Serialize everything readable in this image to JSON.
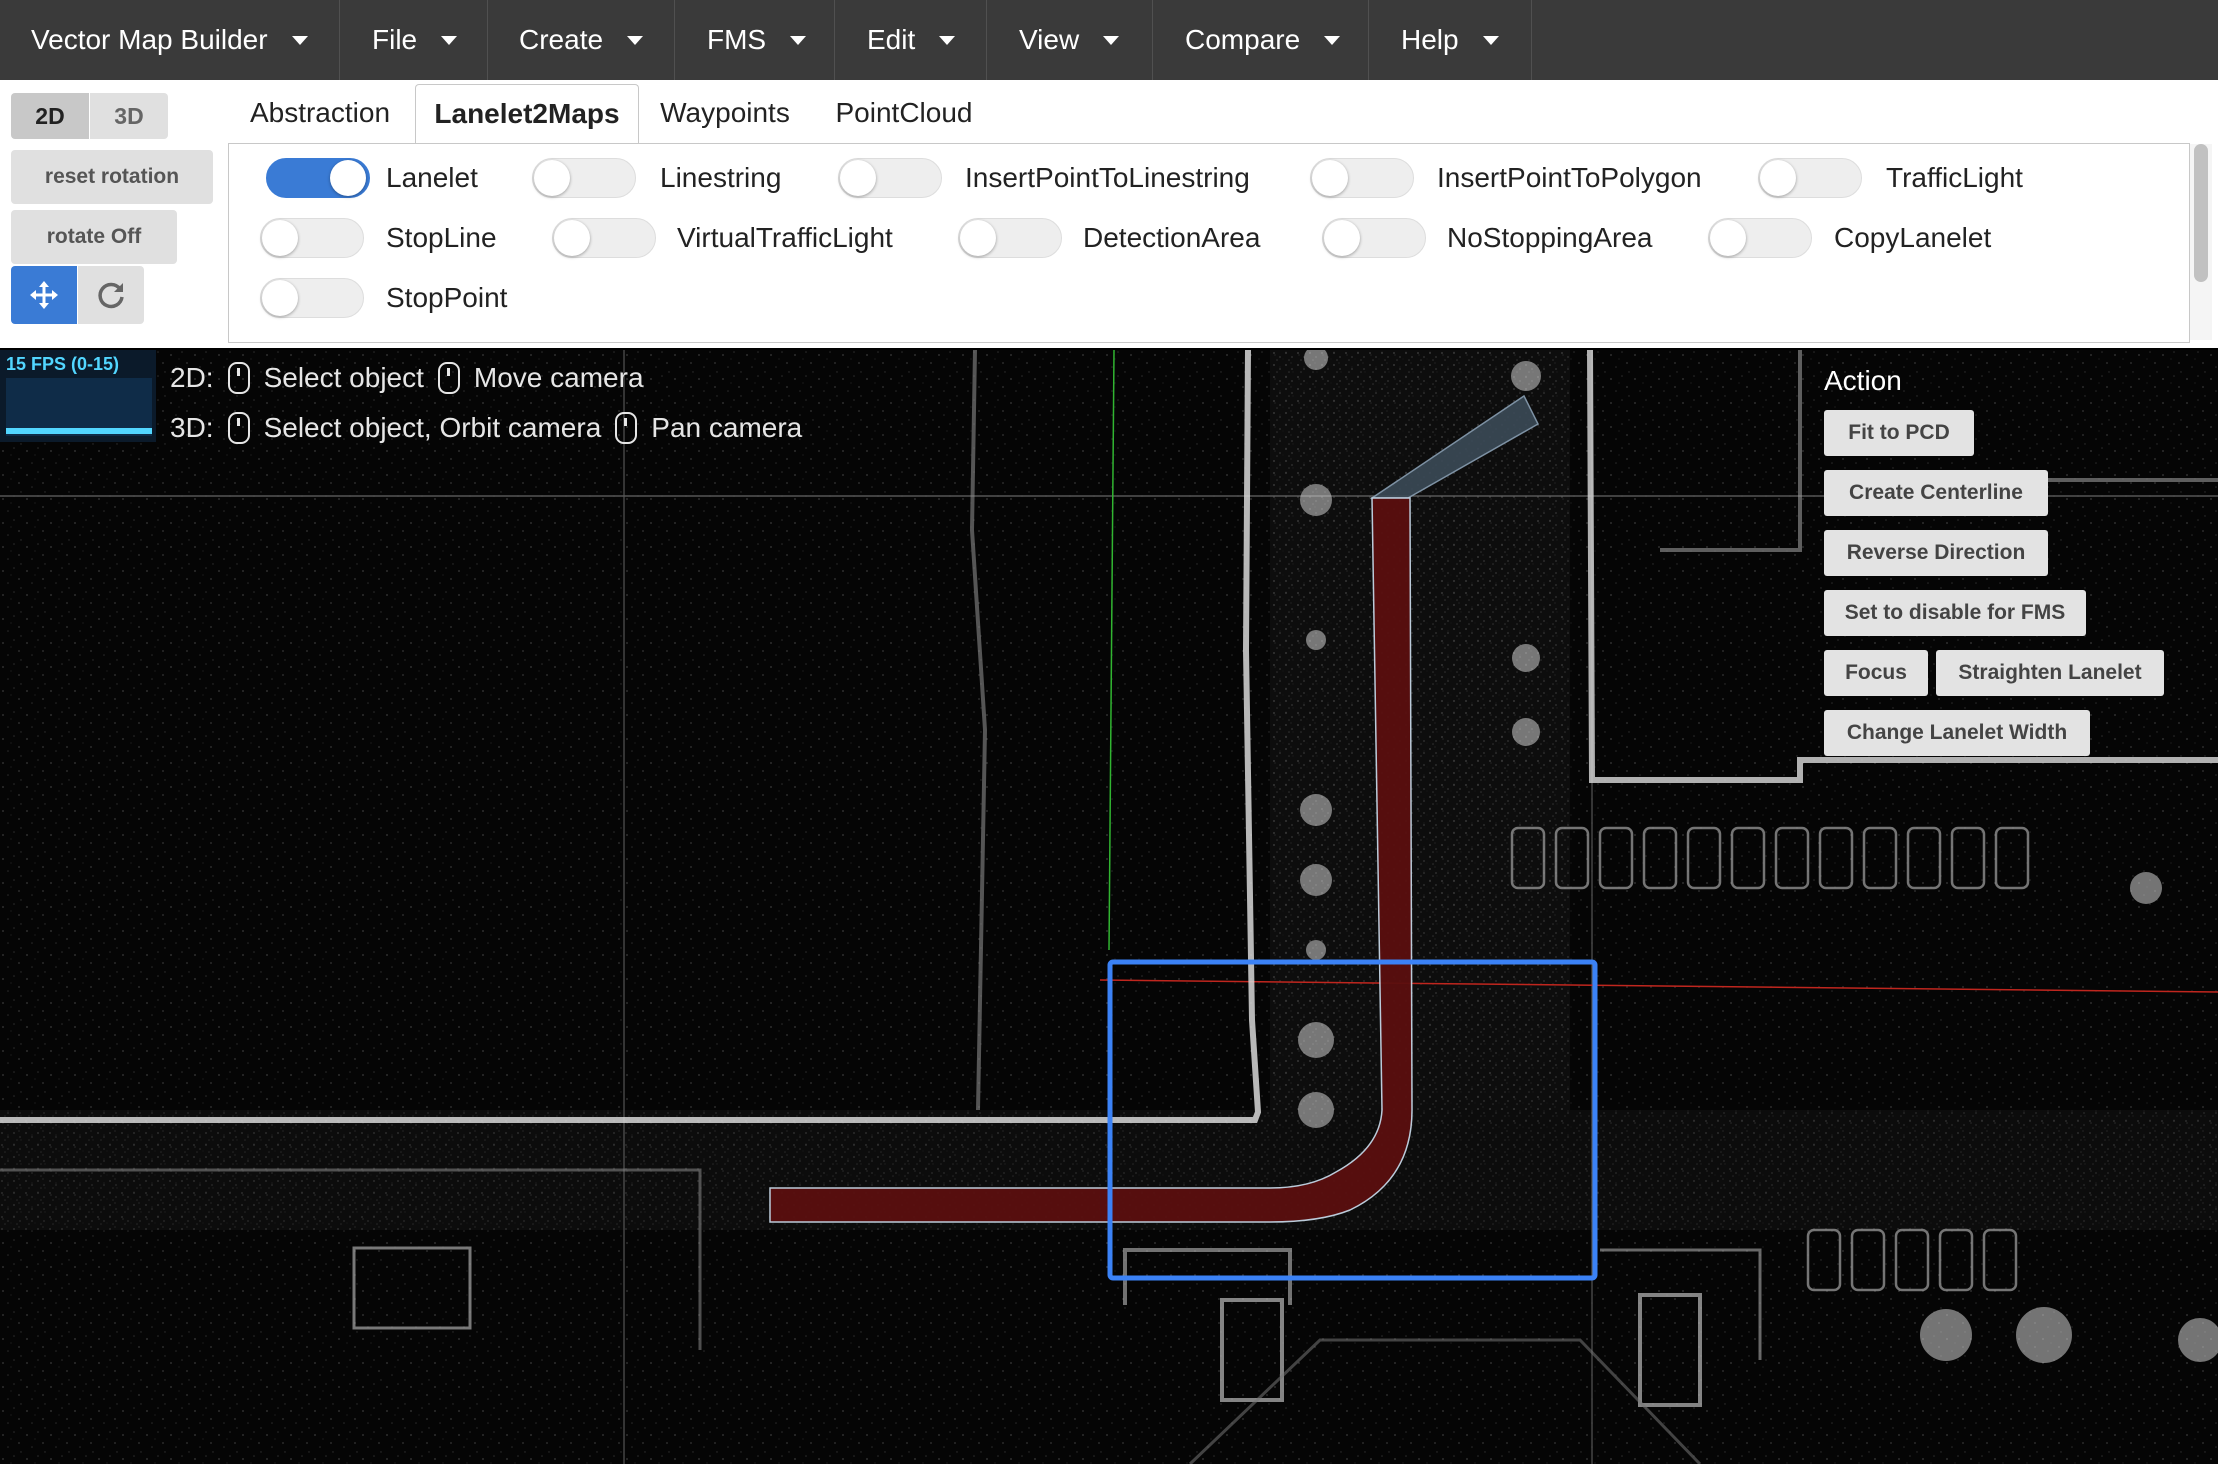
{
  "menubar": {
    "items": [
      "Vector Map Builder",
      "File",
      "Create",
      "FMS",
      "Edit",
      "View",
      "Compare",
      "Help"
    ]
  },
  "view_mode": {
    "options": [
      "2D",
      "3D"
    ],
    "selected": "2D"
  },
  "controls": {
    "reset_rotation": "reset rotation",
    "rotate": "rotate Off"
  },
  "tool_buttons": {
    "move": "move-arrows-icon",
    "refresh": "refresh-icon"
  },
  "tabs": {
    "items": [
      "Abstraction",
      "Lanelet2Maps",
      "Waypoints",
      "PointCloud"
    ],
    "active": "Lanelet2Maps"
  },
  "toggles": [
    {
      "label": "Lanelet",
      "on": true
    },
    {
      "label": "Linestring",
      "on": false
    },
    {
      "label": "InsertPointToLinestring",
      "on": false
    },
    {
      "label": "InsertPointToPolygon",
      "on": false
    },
    {
      "label": "TrafficLight",
      "on": false
    },
    {
      "label": "StopLine",
      "on": false
    },
    {
      "label": "VirtualTrafficLight",
      "on": false
    },
    {
      "label": "DetectionArea",
      "on": false
    },
    {
      "label": "NoStoppingArea",
      "on": false
    },
    {
      "label": "CopyLanelet",
      "on": false
    },
    {
      "label": "StopPoint",
      "on": false
    }
  ],
  "fps": "15 FPS (0-15)",
  "hints": {
    "line1": {
      "prefix": "2D:",
      "a": "Select object",
      "b": "Move camera"
    },
    "line2": {
      "prefix": "3D:",
      "a": "Select object, Orbit camera",
      "b": "Pan camera"
    }
  },
  "actions": {
    "title": "Action",
    "buttons": [
      "Fit to PCD",
      "Create Centerline",
      "Reverse Direction",
      "Set to disable for FMS",
      "Focus",
      "Straighten Lanelet",
      "Change Lanelet Width"
    ]
  },
  "colors": {
    "accent": "#3a7bd5",
    "lanelet_fill": "#5a0f0f",
    "selection_box": "#3b82f6",
    "menubar": "#3a3a3a"
  }
}
